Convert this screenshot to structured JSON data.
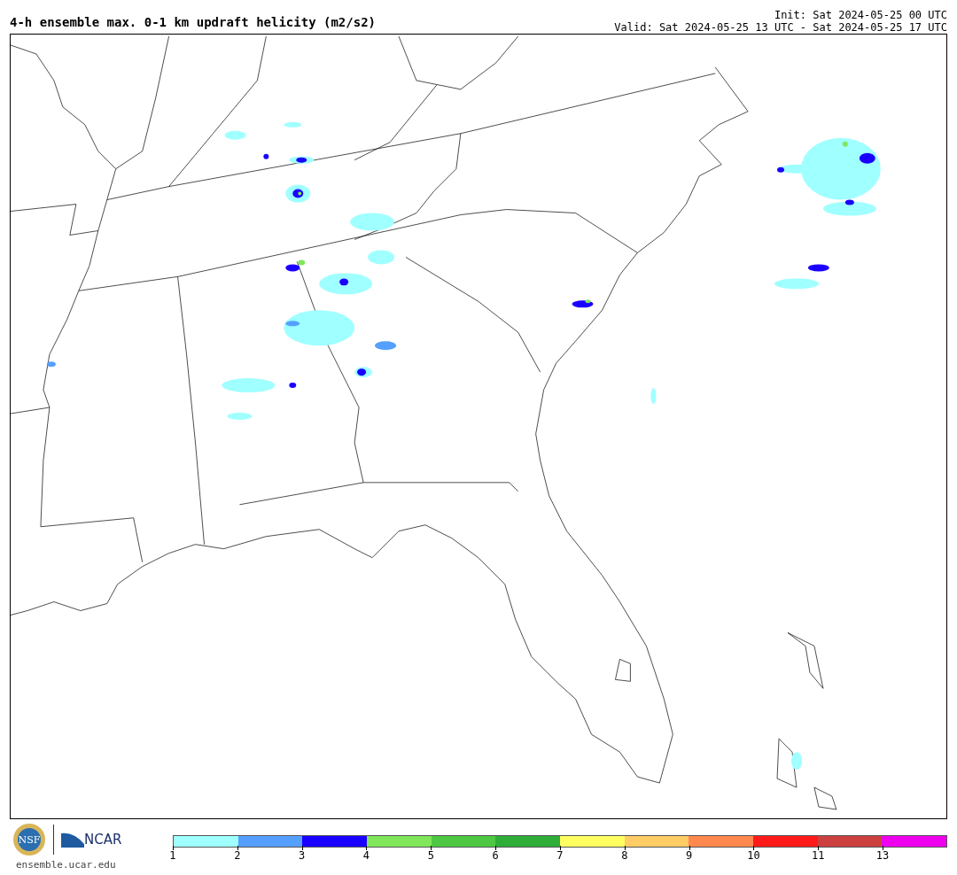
{
  "title": "4-h ensemble max. 0-1 km updraft helicity (m2/s2)",
  "init": "Init: Sat 2024-05-25 00 UTC",
  "valid": "Valid: Sat 2024-05-25 13 UTC - Sat 2024-05-25 17 UTC",
  "logos": {
    "nsf": "NSF",
    "ncar": "NCAR"
  },
  "url": "ensemble.ucar.edu",
  "colorbar": [
    {
      "label": "1",
      "color": "#a0ffff"
    },
    {
      "label": "2",
      "color": "#55a0ff"
    },
    {
      "label": "3",
      "color": "#1a00ff"
    },
    {
      "label": "4",
      "color": "#80e65a"
    },
    {
      "label": "5",
      "color": "#4ec843"
    },
    {
      "label": "6",
      "color": "#2eae38"
    },
    {
      "label": "7",
      "color": "#ffff60"
    },
    {
      "label": "8",
      "color": "#ffcc66"
    },
    {
      "label": "9",
      "color": "#ff884f"
    },
    {
      "label": "10",
      "color": "#ff1a1a"
    },
    {
      "label": "11",
      "color": "#cc4040"
    },
    {
      "label": "13",
      "color": "#ee00ee"
    }
  ]
}
